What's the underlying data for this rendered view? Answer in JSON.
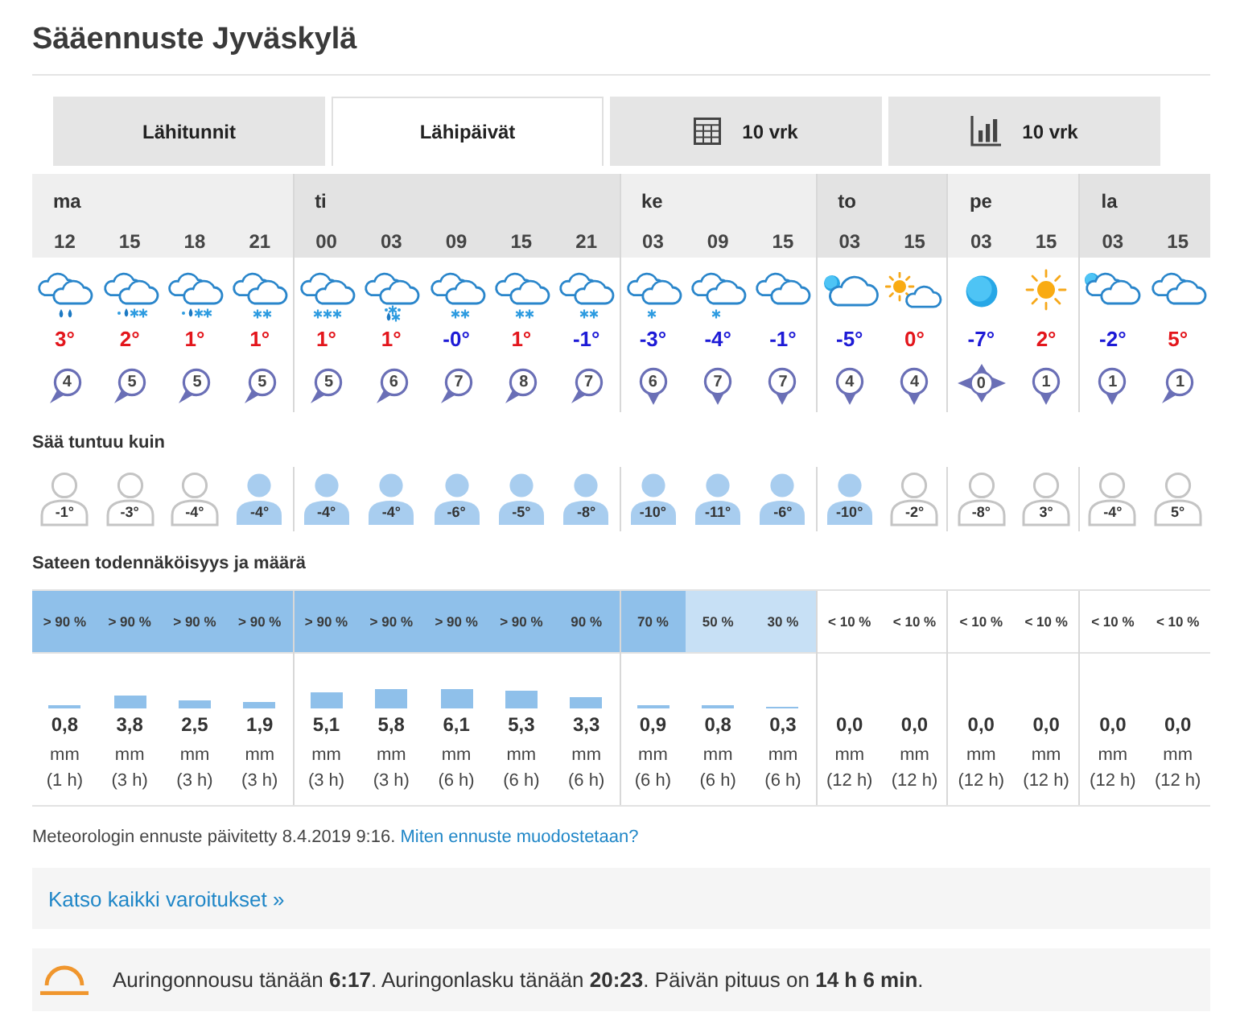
{
  "title": "Sääennuste Jyväskylä",
  "tabs": [
    {
      "label": "Lähitunnit",
      "selected": false,
      "kind": "plain"
    },
    {
      "label": "Lähipäivät",
      "selected": true,
      "kind": "plain"
    },
    {
      "label": "10 vrk",
      "selected": false,
      "kind": "table"
    },
    {
      "label": "10 vrk",
      "selected": false,
      "kind": "chart"
    }
  ],
  "days": [
    {
      "day": "ma",
      "hours": [
        {
          "time": "12",
          "kind": "rain",
          "temperature": {
            "value": "3°",
            "color": "#e3161c"
          },
          "wind": {
            "kind": "down-left",
            "speed": "4"
          },
          "feels_like": {
            "value": "-1°",
            "highlight": false
          },
          "precipitation": {
            "probability": "> 90 %",
            "color": "#8fc0ea",
            "amount": "0,8",
            "unit": "mm",
            "period": "(1 h)"
          }
        },
        {
          "time": "15",
          "kind": "sleet",
          "temperature": {
            "value": "2°",
            "color": "#e3161c"
          },
          "wind": {
            "kind": "down-left",
            "speed": "5"
          },
          "feels_like": {
            "value": "-3°",
            "highlight": false
          },
          "precipitation": {
            "probability": "> 90 %",
            "color": "#8fc0ea",
            "amount": "3,8",
            "unit": "mm",
            "period": "(3 h)"
          }
        },
        {
          "time": "18",
          "kind": "sleet",
          "temperature": {
            "value": "1°",
            "color": "#e3161c"
          },
          "wind": {
            "kind": "down-left",
            "speed": "5"
          },
          "feels_like": {
            "value": "-4°",
            "highlight": false
          },
          "precipitation": {
            "probability": "> 90 %",
            "color": "#8fc0ea",
            "amount": "2,5",
            "unit": "mm",
            "period": "(3 h)"
          }
        },
        {
          "time": "21",
          "kind": "snow",
          "temperature": {
            "value": "1°",
            "color": "#e3161c"
          },
          "wind": {
            "kind": "down-left",
            "speed": "5"
          },
          "feels_like": {
            "value": "-4°",
            "highlight": true
          },
          "precipitation": {
            "probability": "> 90 %",
            "color": "#8fc0ea",
            "amount": "1,9",
            "unit": "mm",
            "period": "(3 h)"
          }
        }
      ]
    },
    {
      "day": "ti",
      "hours": [
        {
          "time": "00",
          "kind": "snow-heavy",
          "temperature": {
            "value": "1°",
            "color": "#e3161c"
          },
          "wind": {
            "kind": "down-left",
            "speed": "5"
          },
          "feels_like": {
            "value": "-4°",
            "highlight": true
          },
          "precipitation": {
            "probability": "> 90 %",
            "color": "#8fc0ea",
            "amount": "5,1",
            "unit": "mm",
            "period": "(3 h)"
          }
        },
        {
          "time": "03",
          "kind": "sleet-showers",
          "temperature": {
            "value": "1°",
            "color": "#e3161c"
          },
          "wind": {
            "kind": "down-left",
            "speed": "6"
          },
          "feels_like": {
            "value": "-4°",
            "highlight": true
          },
          "precipitation": {
            "probability": "> 90 %",
            "color": "#8fc0ea",
            "amount": "5,8",
            "unit": "mm",
            "period": "(3 h)"
          }
        },
        {
          "time": "09",
          "kind": "snow",
          "temperature": {
            "value": "-0°",
            "color": "#1d1ad6"
          },
          "wind": {
            "kind": "down-left",
            "speed": "7"
          },
          "feels_like": {
            "value": "-6°",
            "highlight": true
          },
          "precipitation": {
            "probability": "> 90 %",
            "color": "#8fc0ea",
            "amount": "6,1",
            "unit": "mm",
            "period": "(6 h)"
          }
        },
        {
          "time": "15",
          "kind": "snow",
          "temperature": {
            "value": "1°",
            "color": "#e3161c"
          },
          "wind": {
            "kind": "down-left",
            "speed": "8"
          },
          "feels_like": {
            "value": "-5°",
            "highlight": true
          },
          "precipitation": {
            "probability": "> 90 %",
            "color": "#8fc0ea",
            "amount": "5,3",
            "unit": "mm",
            "period": "(6 h)"
          }
        },
        {
          "time": "21",
          "kind": "snow",
          "temperature": {
            "value": "-1°",
            "color": "#1d1ad6"
          },
          "wind": {
            "kind": "down-left",
            "speed": "7"
          },
          "feels_like": {
            "value": "-8°",
            "highlight": true
          },
          "precipitation": {
            "probability": "90 %",
            "color": "#8fc0ea",
            "amount": "3,3",
            "unit": "mm",
            "period": "(6 h)"
          }
        }
      ]
    },
    {
      "day": "ke",
      "hours": [
        {
          "time": "03",
          "kind": "snow-light",
          "temperature": {
            "value": "-3°",
            "color": "#1d1ad6"
          },
          "wind": {
            "kind": "down",
            "speed": "6"
          },
          "feels_like": {
            "value": "-10°",
            "highlight": true
          },
          "precipitation": {
            "probability": "70 %",
            "color": "#8fc0ea",
            "amount": "0,9",
            "unit": "mm",
            "period": "(6 h)"
          }
        },
        {
          "time": "09",
          "kind": "snow-light",
          "temperature": {
            "value": "-4°",
            "color": "#1d1ad6"
          },
          "wind": {
            "kind": "down",
            "speed": "7"
          },
          "feels_like": {
            "value": "-11°",
            "highlight": true
          },
          "precipitation": {
            "probability": "50 %",
            "color": "#c7e0f5",
            "amount": "0,8",
            "unit": "mm",
            "period": "(6 h)"
          }
        },
        {
          "time": "15",
          "kind": "cloudy",
          "temperature": {
            "value": "-1°",
            "color": "#1d1ad6"
          },
          "wind": {
            "kind": "down",
            "speed": "7"
          },
          "feels_like": {
            "value": "-6°",
            "highlight": true
          },
          "precipitation": {
            "probability": "30 %",
            "color": "#c7e0f5",
            "amount": "0,3",
            "unit": "mm",
            "period": "(6 h)"
          }
        }
      ]
    },
    {
      "day": "to",
      "hours": [
        {
          "time": "03",
          "kind": "partly-cloudy-night",
          "temperature": {
            "value": "-5°",
            "color": "#1d1ad6"
          },
          "wind": {
            "kind": "down",
            "speed": "4"
          },
          "feels_like": {
            "value": "-10°",
            "highlight": true
          },
          "precipitation": {
            "probability": "< 10 %",
            "color": "#ffffff",
            "amount": "0,0",
            "unit": "mm",
            "period": "(12 h)"
          }
        },
        {
          "time": "15",
          "kind": "partly-sunny",
          "temperature": {
            "value": "0°",
            "color": "#e3161c"
          },
          "wind": {
            "kind": "down",
            "speed": "4"
          },
          "feels_like": {
            "value": "-2°",
            "highlight": false
          },
          "precipitation": {
            "probability": "< 10 %",
            "color": "#ffffff",
            "amount": "0,0",
            "unit": "mm",
            "period": "(12 h)"
          }
        }
      ]
    },
    {
      "day": "pe",
      "hours": [
        {
          "time": "03",
          "kind": "clear-night",
          "temperature": {
            "value": "-7°",
            "color": "#1d1ad6"
          },
          "wind": {
            "kind": "calm",
            "speed": "0"
          },
          "feels_like": {
            "value": "-8°",
            "highlight": false
          },
          "precipitation": {
            "probability": "< 10 %",
            "color": "#ffffff",
            "amount": "0,0",
            "unit": "mm",
            "period": "(12 h)"
          }
        },
        {
          "time": "15",
          "kind": "sunny",
          "temperature": {
            "value": "2°",
            "color": "#e3161c"
          },
          "wind": {
            "kind": "down",
            "speed": "1"
          },
          "feels_like": {
            "value": "3°",
            "highlight": false
          },
          "precipitation": {
            "probability": "< 10 %",
            "color": "#ffffff",
            "amount": "0,0",
            "unit": "mm",
            "period": "(12 h)"
          }
        }
      ]
    },
    {
      "day": "la",
      "hours": [
        {
          "time": "03",
          "kind": "mostly-cloudy-night",
          "temperature": {
            "value": "-2°",
            "color": "#1d1ad6"
          },
          "wind": {
            "kind": "down",
            "speed": "1"
          },
          "feels_like": {
            "value": "-4°",
            "highlight": false
          },
          "precipitation": {
            "probability": "< 10 %",
            "color": "#ffffff",
            "amount": "0,0",
            "unit": "mm",
            "period": "(12 h)"
          }
        },
        {
          "time": "15",
          "kind": "cloudy",
          "temperature": {
            "value": "5°",
            "color": "#e3161c"
          },
          "wind": {
            "kind": "down-left",
            "speed": "1"
          },
          "feels_like": {
            "value": "5°",
            "highlight": false
          },
          "precipitation": {
            "probability": "< 10 %",
            "color": "#ffffff",
            "amount": "0,0",
            "unit": "mm",
            "period": "(12 h)"
          }
        }
      ]
    }
  ],
  "feels_like_label": "Sää tuntuu kuin",
  "precipitation_label": "Sateen todennäköisyys ja määrä",
  "update_note": {
    "text": "Meteorologin ennuste päivitetty 8.4.2019 9:16.",
    "link": "Miten ennuste muodostetaan?"
  },
  "warnings_link": "Katso kaikki varoitukset »",
  "sun_info": "Auringonnousu tänään **6:17**. Auringonlasku tänään **20:23**. Päivän pituus on **14 h 6 min**."
}
